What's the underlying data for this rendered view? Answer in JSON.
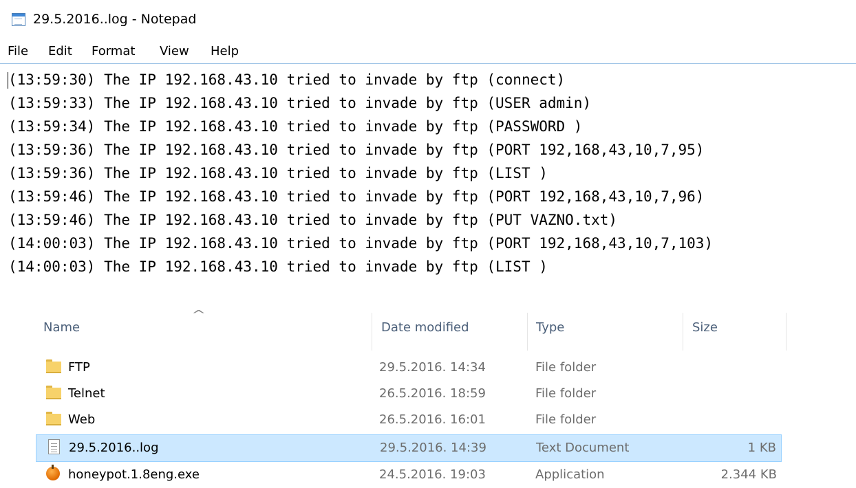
{
  "window": {
    "title": "29.5.2016..log - Notepad",
    "icon": "notepad-icon"
  },
  "menu": [
    "File",
    "Edit",
    "Format",
    "View",
    "Help"
  ],
  "log_lines": [
    "(13:59:30) The IP 192.168.43.10 tried to invade by ftp (connect)",
    "(13:59:33) The IP 192.168.43.10 tried to invade by ftp (USER admin)",
    "(13:59:34) The IP 192.168.43.10 tried to invade by ftp (PASSWORD )",
    "(13:59:36) The IP 192.168.43.10 tried to invade by ftp (PORT 192,168,43,10,7,95)",
    "(13:59:36) The IP 192.168.43.10 tried to invade by ftp (LIST )",
    "(13:59:46) The IP 192.168.43.10 tried to invade by ftp (PORT 192,168,43,10,7,96)",
    "(13:59:46) The IP 192.168.43.10 tried to invade by ftp (PUT VAZNO.txt)",
    "(14:00:03) The IP 192.168.43.10 tried to invade by ftp (PORT 192,168,43,10,7,103)",
    "(14:00:03) The IP 192.168.43.10 tried to invade by ftp (LIST )"
  ],
  "explorer": {
    "columns": {
      "name": "Name",
      "date": "Date modified",
      "type": "Type",
      "size": "Size"
    },
    "sort_indicator": "^",
    "files": [
      {
        "name": "FTP",
        "date": "29.5.2016. 14:34",
        "type": "File folder",
        "size": "",
        "icon": "folder-icon",
        "selected": false
      },
      {
        "name": "Telnet",
        "date": "26.5.2016. 18:59",
        "type": "File folder",
        "size": "",
        "icon": "folder-icon",
        "selected": false
      },
      {
        "name": "Web",
        "date": "26.5.2016. 16:01",
        "type": "File folder",
        "size": "",
        "icon": "folder-icon",
        "selected": false
      },
      {
        "name": "29.5.2016..log",
        "date": "29.5.2016. 14:39",
        "type": "Text Document",
        "size": "1 KB",
        "icon": "text-document-icon",
        "selected": true
      },
      {
        "name": "honeypot.1.8eng.exe",
        "date": "24.5.2016. 19:03",
        "type": "Application",
        "size": "2.344 KB",
        "icon": "application-icon",
        "selected": false
      }
    ]
  },
  "colors": {
    "selection_bg": "#cce8ff",
    "selection_border": "#99d1ff",
    "header_text": "#4c607a",
    "folder": "#f7d26a"
  }
}
